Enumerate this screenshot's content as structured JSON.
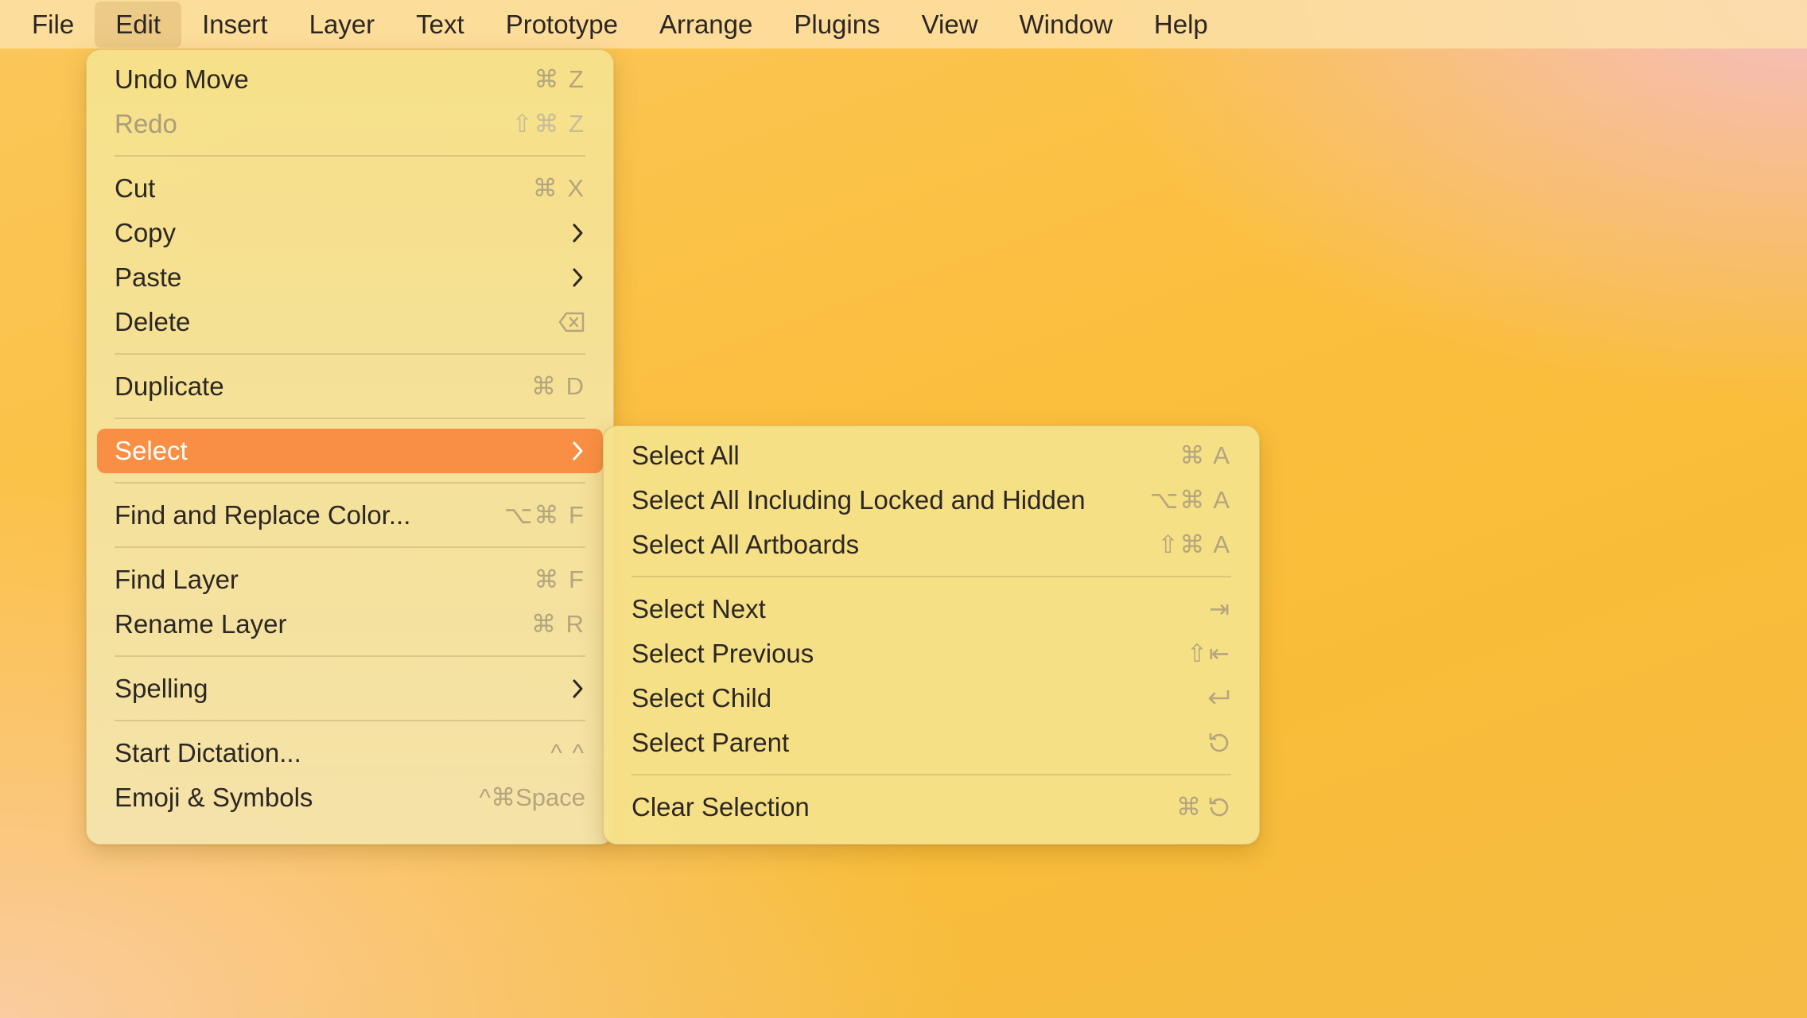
{
  "menubar": {
    "items": [
      {
        "label": "File"
      },
      {
        "label": "Edit"
      },
      {
        "label": "Insert"
      },
      {
        "label": "Layer"
      },
      {
        "label": "Text"
      },
      {
        "label": "Prototype"
      },
      {
        "label": "Arrange"
      },
      {
        "label": "Plugins"
      },
      {
        "label": "View"
      },
      {
        "label": "Window"
      },
      {
        "label": "Help"
      }
    ],
    "active": "Edit"
  },
  "edit_menu": {
    "undo": {
      "label": "Undo Move",
      "shortcut": "⌘ Z"
    },
    "redo": {
      "label": "Redo",
      "shortcut": "⇧⌘ Z"
    },
    "cut": {
      "label": "Cut",
      "shortcut": "⌘ X"
    },
    "copy": {
      "label": "Copy"
    },
    "paste": {
      "label": "Paste"
    },
    "delete": {
      "label": "Delete",
      "shortcut_icon": "delete-backward-icon"
    },
    "duplicate": {
      "label": "Duplicate",
      "shortcut": "⌘ D"
    },
    "select": {
      "label": "Select"
    },
    "find_replace_color": {
      "label": "Find and Replace Color...",
      "shortcut": "⌥⌘ F"
    },
    "find_layer": {
      "label": "Find Layer",
      "shortcut": "⌘ F"
    },
    "rename_layer": {
      "label": "Rename Layer",
      "shortcut": "⌘ R"
    },
    "spelling": {
      "label": "Spelling"
    },
    "start_dictation": {
      "label": "Start Dictation...",
      "shortcut": "^ ^"
    },
    "emoji_symbols": {
      "label": "Emoji & Symbols",
      "shortcut": "^⌘Space"
    }
  },
  "select_submenu": {
    "select_all": {
      "label": "Select All",
      "shortcut": "⌘ A"
    },
    "select_all_locked_hidden": {
      "label": "Select All Including Locked and Hidden",
      "shortcut": "⌥⌘ A"
    },
    "select_all_artboards": {
      "label": "Select All Artboards",
      "shortcut": "⇧⌘ A"
    },
    "select_next": {
      "label": "Select Next",
      "shortcut": "⇥"
    },
    "select_previous": {
      "label": "Select Previous",
      "shortcut": "⇧⇤"
    },
    "select_child": {
      "label": "Select Child",
      "shortcut_icon": "return-icon"
    },
    "select_parent": {
      "label": "Select Parent",
      "shortcut_icon": "rotate-ccw-icon"
    },
    "clear_selection": {
      "label": "Clear Selection",
      "shortcut_prefix": "⌘",
      "shortcut_icon": "rotate-ccw-icon"
    }
  },
  "colors": {
    "highlight": "#f98f44",
    "shortcut_text": "#b4a57d",
    "menu_background": "#f5e28c"
  }
}
